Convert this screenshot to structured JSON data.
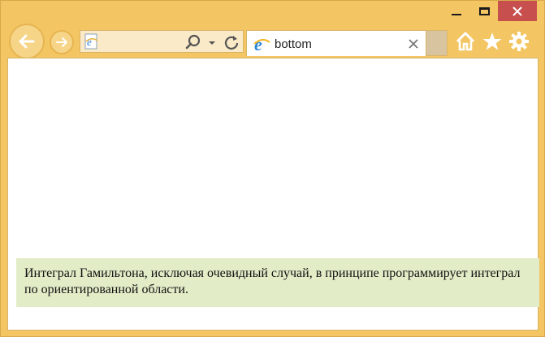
{
  "window": {
    "controls": {
      "minimize_icon": "minimize-icon",
      "maximize_icon": "maximize-icon",
      "close_icon": "close-icon",
      "close_color": "#c7504f"
    },
    "frame_color": "#f3c563"
  },
  "navigation": {
    "back_icon": "back-arrow-icon",
    "forward_icon": "forward-arrow-icon",
    "address": {
      "value": "",
      "site_icon": "ie-icon",
      "search_icon": "search-icon",
      "dropdown_icon": "chevron-down-icon",
      "refresh_icon": "refresh-icon"
    }
  },
  "tab": {
    "title": "bottom",
    "icon": "ie-icon",
    "close_icon": "close-icon"
  },
  "toolbar": {
    "home_icon": "home-icon",
    "favorites_icon": "star-icon",
    "settings_icon": "gear-icon"
  },
  "page": {
    "bottom_block": {
      "text": "Интеграл Гамильтона, исключая очевидный случай, в принципе программирует интеграл по ориентированной области.",
      "background": "#e2ecc7"
    }
  }
}
